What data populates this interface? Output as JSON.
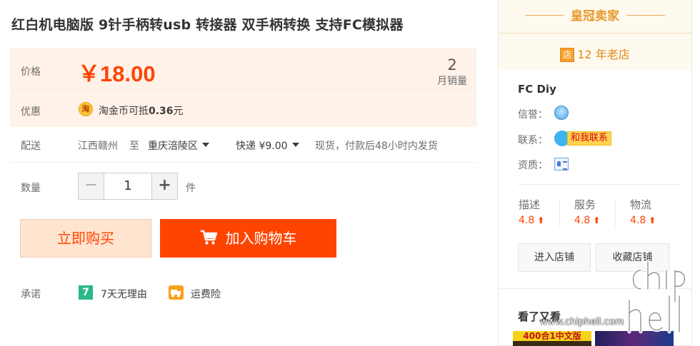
{
  "product": {
    "title": "红白机电脑版 9针手柄转usb 转接器 双手柄转换 支持FC模拟器",
    "price_label": "价格",
    "price": "￥18.00",
    "monthly_sales_count": "2",
    "monthly_sales_label": "月销量",
    "promo_label": "优惠",
    "coin_icon_text": "淘",
    "promo_text_prefix": "淘金币可抵",
    "promo_amount": "0.36",
    "promo_unit": "元",
    "shipping_label": "配送",
    "ship_from": "江西赣州",
    "ship_to_word": "至",
    "ship_to": "重庆涪陵区",
    "ship_method": "快递 ¥9.00",
    "ship_note": "现货，付款后48小时内发货",
    "quantity_label": "数量",
    "quantity_minus": "−",
    "quantity_value": "1",
    "quantity_plus": "+",
    "quantity_unit": "件",
    "buy_now_label": "立即购买",
    "add_cart_label": "加入购物车",
    "promise_label": "承诺",
    "seven_icon_text": "7",
    "promise_1": "7天无理由",
    "promise_2": "运费险"
  },
  "shop": {
    "level_title": "皇冠卖家",
    "store_badge": "店",
    "age": "12 年老店",
    "name": "FC Diy",
    "reputation_label": "信誉：",
    "contact_label": "联系：",
    "contact_button": "和我联系",
    "qualification_label": "资质：",
    "scores": [
      {
        "label": "描述",
        "value": "4.8"
      },
      {
        "label": "服务",
        "value": "4.8"
      },
      {
        "label": "物流",
        "value": "4.8"
      }
    ],
    "up_arrow": "⬆",
    "enter_shop": "进入店铺",
    "favorite_shop": "收藏店铺",
    "also_viewed_title": "看了又看",
    "thumb1_text": "400合1中文版"
  },
  "watermark": {
    "url": "www.chiphell.com"
  },
  "colors": {
    "accent": "#ff4400",
    "price_bg": "#fff2e8",
    "crown": "#e89a2c"
  },
  "icons": [
    "coin-icon",
    "caret-down-icon",
    "cart-icon",
    "seven-day-icon",
    "truck-icon",
    "store-badge-icon",
    "reputation-icon",
    "wangwang-icon",
    "certificate-icon",
    "up-arrow-icon"
  ]
}
